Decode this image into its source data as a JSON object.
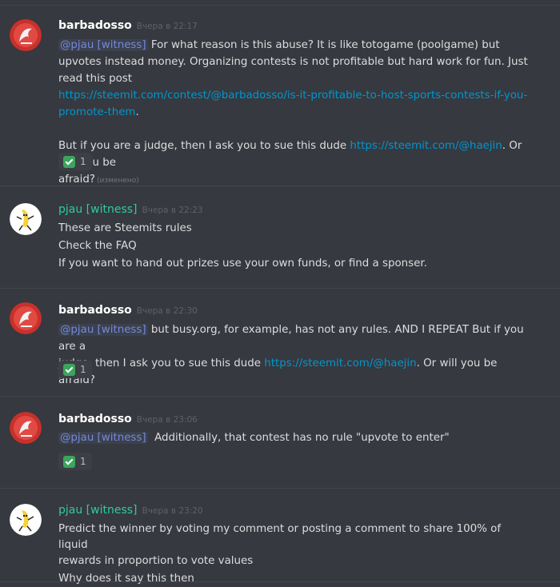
{
  "messages": [
    {
      "author": "barbadosso",
      "timestamp": "Вчера в 22:17",
      "mention": "@pjau [witness]",
      "text_1": "For what reason is this abuse? It is like totogame (poolgame) but upvotes instead money. Organizing contests is not profitable but hard work for fun. Just read this post",
      "link_1a": "https://steemit.com/contest/@barbadosso/is-it-profitable-to-host-sports-contests-if-you-",
      "link_1b": "promote-them",
      "period": ".",
      "text_2": "But if you are a judge, then I ask you to sue this dude",
      "link_2": "https://steemit.com/@haejin",
      "text_3a": ". Or will you be",
      "text_3b": "afraid?",
      "edited": "(изменено)",
      "reaction": {
        "icon": "white-check-mark-icon",
        "count": "1"
      }
    },
    {
      "author": "pjau [witness]",
      "timestamp": "Вчера в 22:23",
      "lines": [
        "These are Steemits rules",
        "Check the FAQ",
        "If you want to hand out prizes use your own funds, or find a sponser."
      ]
    },
    {
      "author": "barbadosso",
      "timestamp": "Вчера в 22:30",
      "mention": "@pjau [witness]",
      "text_1": "but busy.org, for example, has not any rules. AND I REPEAT But if you are a",
      "text_2": "judge, then I ask you to sue this dude",
      "link": "https://steemit.com/@haejin",
      "text_3": ". Or will you be afraid?",
      "reaction": {
        "icon": "white-check-mark-icon",
        "count": "1"
      }
    },
    {
      "author": "barbadosso",
      "timestamp": "Вчера в 23:06",
      "mention": "@pjau [witness]",
      "text": "Additionally, that contest has no rule \"upvote to enter\"",
      "reaction": {
        "icon": "white-check-mark-icon",
        "count": "1"
      }
    },
    {
      "author": "pjau [witness]",
      "timestamp": "Вчера в 23:20",
      "lines": [
        "Predict the winner by voting my comment or posting a comment to share 100% of liquid",
        "rewards in proportion to vote values",
        "Why does it say this then"
      ]
    }
  ],
  "colors": {
    "background": "#36393f",
    "username_green": "#2ecc9c",
    "mention": "#7289da",
    "link": "#0096cf",
    "reaction_check": "#3ba55c"
  }
}
